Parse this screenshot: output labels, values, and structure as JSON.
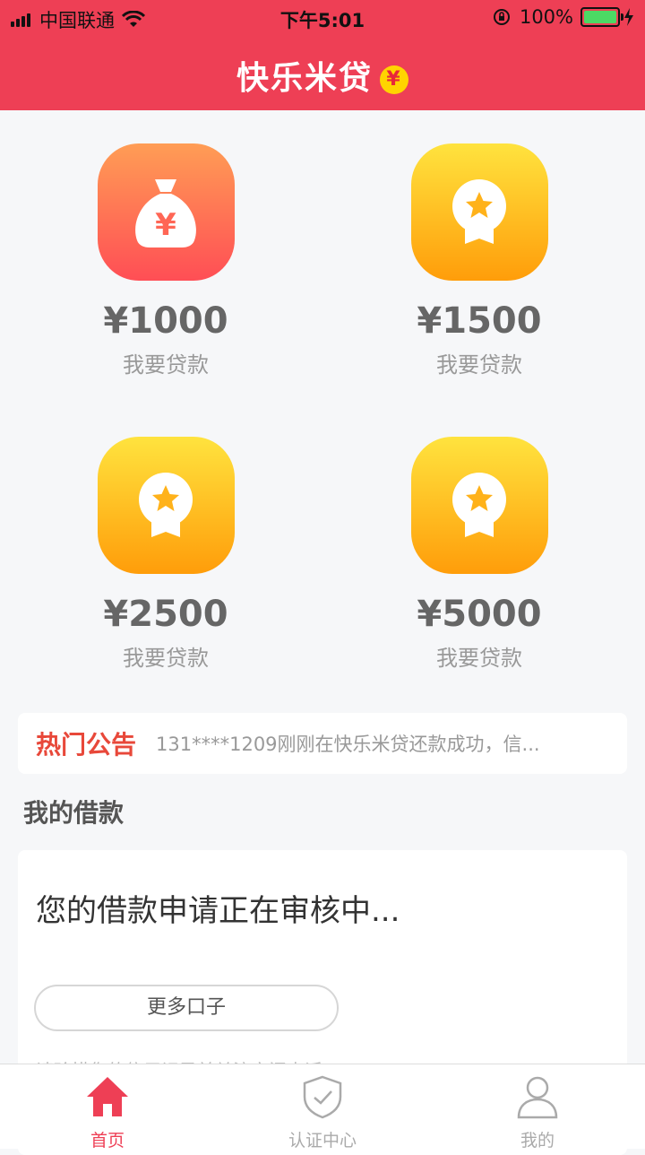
{
  "status_bar": {
    "carrier": "中国联通",
    "time": "下午5:01",
    "battery": "100%"
  },
  "header": {
    "title": "快乐米贷",
    "badge": "¥",
    "color": "#ee3f55"
  },
  "loans": [
    {
      "amount": "¥1000",
      "label": "我要贷款",
      "icon": "money-bag-icon",
      "color": "red"
    },
    {
      "amount": "¥1500",
      "label": "我要贷款",
      "icon": "medal-icon",
      "color": "gold"
    },
    {
      "amount": "¥2500",
      "label": "我要贷款",
      "icon": "medal-icon",
      "color": "gold"
    },
    {
      "amount": "¥5000",
      "label": "我要贷款",
      "icon": "medal-icon",
      "color": "gold"
    }
  ],
  "notice": {
    "tag": "热门公告",
    "text": "131****1209刚刚在快乐米贷还款成功，信..."
  },
  "my_loans": {
    "title": "我的借款",
    "status": "您的借款申请正在审核中...",
    "button": "更多口子",
    "note": "请珍惜您的信用记录并关注审阅电话"
  },
  "tabbar": {
    "items": [
      {
        "label": "首页",
        "icon": "home-icon",
        "active": true
      },
      {
        "label": "认证中心",
        "icon": "shield-check-icon",
        "active": false
      },
      {
        "label": "我的",
        "icon": "user-icon",
        "active": false
      }
    ]
  }
}
